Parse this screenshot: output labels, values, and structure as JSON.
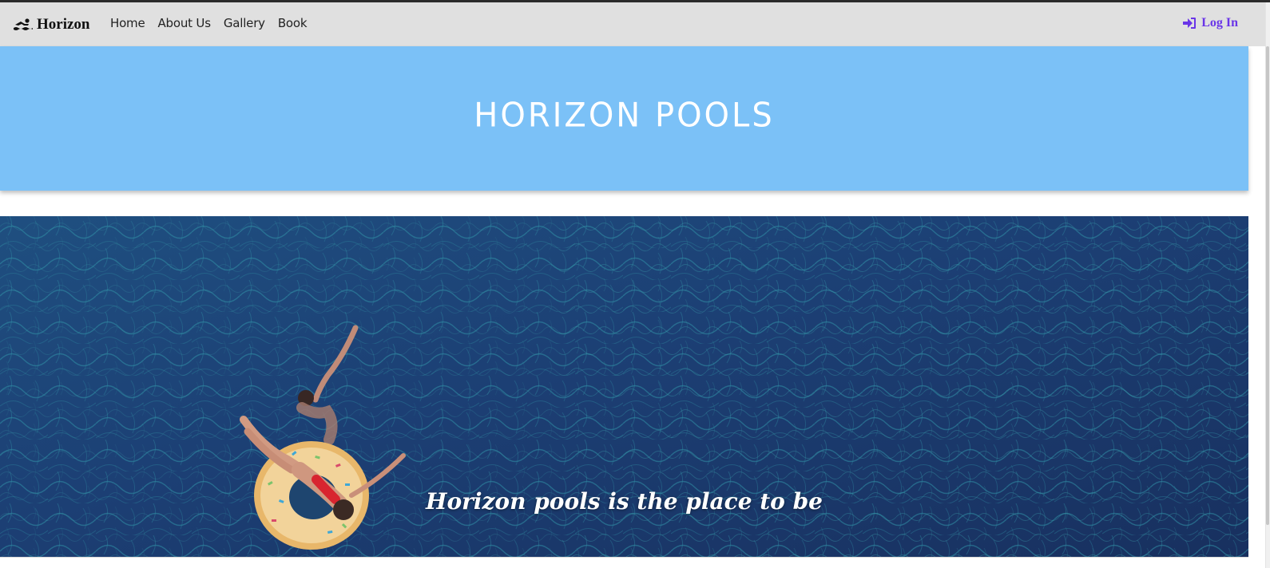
{
  "navbar": {
    "brand": "Horizon",
    "brand_icon": "swimmer-icon",
    "links": [
      {
        "label": "Home"
      },
      {
        "label": "About Us"
      },
      {
        "label": "Gallery"
      },
      {
        "label": "Book"
      }
    ],
    "login_label": "Log In",
    "login_icon": "sign-in-icon"
  },
  "hero": {
    "title": "HORIZON POOLS"
  },
  "pool_section": {
    "tagline": "Horizon pools is the place to be",
    "image_description_icon": "pool-photo"
  },
  "colors": {
    "navbar_bg": "#e0e0e0",
    "hero_bg": "#7bc1f7",
    "login_color": "#6a35e8",
    "water_dark": "#1b3c70",
    "water_light": "#2a8aa0"
  }
}
